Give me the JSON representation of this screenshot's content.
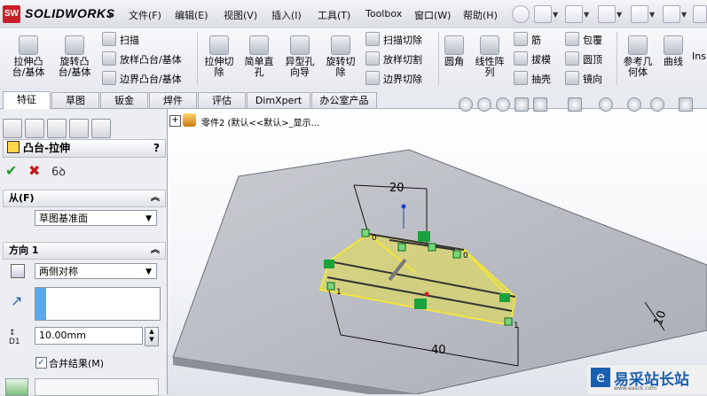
{
  "app": {
    "brand": "SOLIDWORKS",
    "brand_logo": "SW",
    "separator": "▸"
  },
  "menubar": {
    "items": [
      "文件(F)",
      "编辑(E)",
      "视图(V)",
      "插入(I)",
      "工具(T)",
      "Toolbox",
      "窗口(W)",
      "帮助(H)"
    ]
  },
  "commands": {
    "extrude_boss": "拉伸凸\n台/基体",
    "revolve_boss": "旋转凸\n台/基体",
    "sweep": "扫描",
    "loft": "放样凸台/基体",
    "boundary_boss": "边界凸台/基体",
    "extrude_cut": "拉伸切\n除",
    "simple_hole": "简单直\n孔",
    "hole_wizard": "异型孔\n向导",
    "revolve_cut": "旋转切\n除",
    "swept_cut": "扫描切除",
    "lofted_cut": "放样切割",
    "boundary_cut": "边界切除",
    "fillet": "圆角",
    "linear_pattern": "线性阵\n列",
    "rib": "筋",
    "draft": "拔模",
    "shell": "抽壳",
    "wrap": "包覆",
    "dome": "圆顶",
    "mirror": "镜向",
    "ref_geometry": "参考几\n何体",
    "curves": "曲线",
    "instant3d": "Ins"
  },
  "tabs": [
    "特征",
    "草图",
    "钣金",
    "焊件",
    "评估",
    "DimXpert",
    "办公室产品"
  ],
  "tree": {
    "part_label": "零件2 (默认<<默认>_显示..."
  },
  "property_manager": {
    "title": "凸台-拉伸",
    "help": "?",
    "ok": "✔",
    "cancel": "✖",
    "preview": "6ꝺ",
    "from": {
      "heading": "从(F)",
      "value": "草图基准面"
    },
    "direction1": {
      "heading": "方向 1",
      "end_condition": "两侧对称",
      "depth": "10.00mm",
      "depth_label": "D1",
      "merge_result": "合并结果(M)",
      "merge_checked": true
    }
  },
  "dimensions": {
    "top": "20",
    "bottom": "40",
    "right": "10"
  },
  "handle_labels": {
    "zero": "0",
    "one": "1"
  },
  "watermark": {
    "text": "易采站长站",
    "url": "www.easck.com"
  },
  "colors": {
    "preview_fill": "#e8e04a",
    "preview_edge": "#f3e53a",
    "handle": "#1aa23c",
    "plate": "#b8bcc2"
  }
}
